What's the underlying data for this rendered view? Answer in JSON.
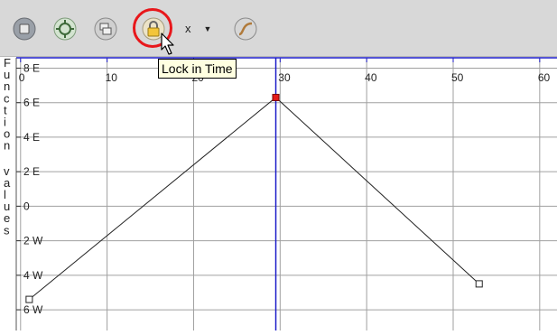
{
  "toolbar": {
    "buttons": [
      {
        "icon": "frame-all-icon"
      },
      {
        "icon": "refresh-cycle-icon"
      },
      {
        "icon": "stacked-frames-icon"
      },
      {
        "icon": "lock-icon"
      },
      {
        "icon": "curve-icon"
      }
    ],
    "axis_dropdown": {
      "value": "x"
    }
  },
  "tooltip": {
    "text": "Lock in Time"
  },
  "y_axis_title": "Function values",
  "chart_data": {
    "type": "line",
    "xlabel": "",
    "ylabel": "Function values",
    "x_ticks": [
      "0",
      "10",
      "20",
      "30",
      "40",
      "50",
      "60"
    ],
    "y_ticks": [
      "8 E",
      "6 E",
      "4 E",
      "2 E",
      "0",
      "2 W",
      "4 W",
      "6 W"
    ],
    "x_range": [
      -0.5,
      62
    ],
    "y_range": [
      -7.2,
      8.6
    ],
    "grid": true,
    "current_time": 29.5,
    "series": [
      {
        "values": [
          {
            "x": 1,
            "y": -5.4,
            "selected": false
          },
          {
            "x": 29.5,
            "y": 6.3,
            "selected": true
          },
          {
            "x": 53,
            "y": -4.5,
            "selected": false
          }
        ]
      }
    ],
    "colors": {
      "grid": "#a0a0a0",
      "frame_marker": "#1c1cc8",
      "line": "#222222",
      "selected_key": "#e31b1b",
      "key": "#ffffff"
    }
  }
}
